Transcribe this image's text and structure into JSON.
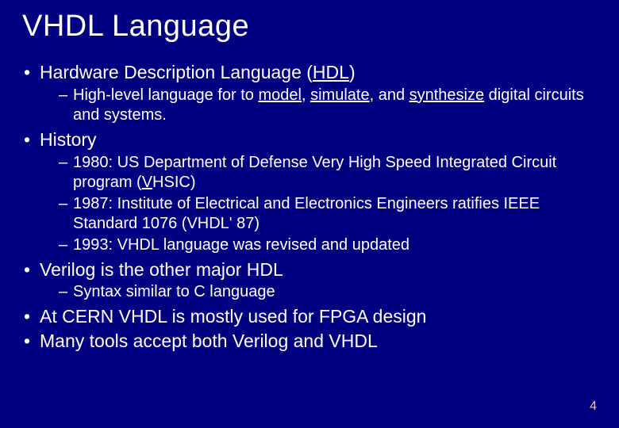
{
  "title": "VHDL Language",
  "bullets": {
    "b1": {
      "pre": "Hardware Description Language (",
      "u": "HDL",
      "post": ")"
    },
    "b1s1": {
      "pre": "High-level language for to ",
      "u1": "model",
      "m1": ", ",
      "u2": "simulate",
      "m2": ", and ",
      "u3": "synthesize",
      "post": " digital circuits and systems."
    },
    "b2": "History",
    "b2s1": {
      "pre": "1980: US Department of Defense Very High Speed Integrated Circuit program (",
      "u": "V",
      "post": "HSIC)"
    },
    "b2s2": "1987: Institute of Electrical and Electronics Engineers ratifies IEEE Standard 1076 (VHDL' 87)",
    "b2s3": "1993: VHDL language was revised and updated",
    "b3": "Verilog is the other major HDL",
    "b3s1": "Syntax similar to C language",
    "b4": "At CERN VHDL is mostly used for FPGA design",
    "b5": "Many tools accept both Verilog and VHDL"
  },
  "page_number": "4"
}
